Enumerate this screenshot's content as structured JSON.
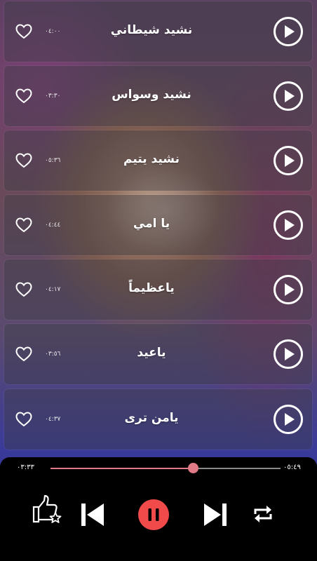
{
  "playlist": [
    {
      "title": "نشيد شيطاني",
      "duration": "٠٤:٠٠"
    },
    {
      "title": "نشيد وسواس",
      "duration": "٠٣:٣٠"
    },
    {
      "title": "نشيد يتيم",
      "duration": "٠٥:٣٦"
    },
    {
      "title": "يا امي",
      "duration": "٠٤:٤٤"
    },
    {
      "title": "ياعظيماً",
      "duration": "٠٤:١٧"
    },
    {
      "title": "ياعيد",
      "duration": "٠٣:٥٦"
    },
    {
      "title": "يامن ترى",
      "duration": "٠٤:٣٧"
    }
  ],
  "player": {
    "elapsed": "٠٣:٣٣",
    "total": "٠٥:٤٩",
    "progress": 0.62,
    "state": "playing"
  },
  "colors": {
    "accent": "#e07a86",
    "pause_button": "#f04a4a",
    "player_bg": "#000000"
  },
  "icons": {
    "favorite": "heart-outline-icon",
    "play": "play-circle-icon",
    "rate": "thumbs-up-star-icon",
    "previous": "skip-previous-icon",
    "pause": "pause-icon",
    "next": "skip-next-icon",
    "repeat": "repeat-icon"
  }
}
